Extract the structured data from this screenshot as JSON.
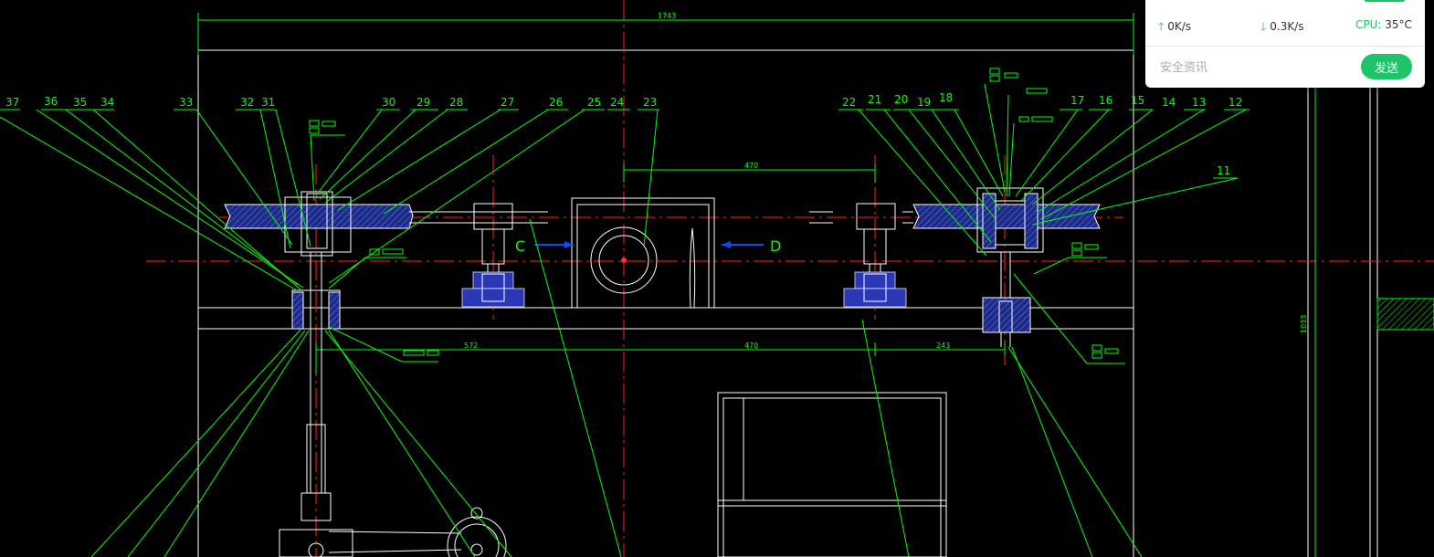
{
  "drawing": {
    "part_numbers_left": [
      "37",
      "36",
      "35",
      "34",
      "33",
      "32",
      "31",
      "30",
      "29",
      "28",
      "27",
      "26",
      "25",
      "24",
      "23"
    ],
    "part_numbers_right": [
      "22",
      "21",
      "20",
      "19",
      "18",
      "17",
      "16",
      "15",
      "14",
      "13",
      "12",
      "11"
    ],
    "dimensions": {
      "overall_width": "1743",
      "top_span": "470",
      "bottom_left": "572",
      "bottom_mid": "470",
      "bottom_right": "243",
      "height": "1033"
    },
    "section_marks": {
      "left": "C",
      "right": "D"
    },
    "colors": {
      "background": "#000000",
      "leader": "#00ff00",
      "outline": "#ffffff",
      "centerline": "#ff2020",
      "bearing": "#2a38b8",
      "arrow": "#0050ff"
    }
  },
  "widget": {
    "upload": {
      "icon": "arrow-up-icon",
      "value": "0K/s"
    },
    "download": {
      "icon": "arrow-down-icon",
      "value": "0.3K/s"
    },
    "cpu": {
      "label": "CPU:",
      "value": "35°C"
    },
    "message": {
      "placeholder": "安全资讯"
    },
    "send_label": "发送",
    "accent": "#1ec46a"
  }
}
